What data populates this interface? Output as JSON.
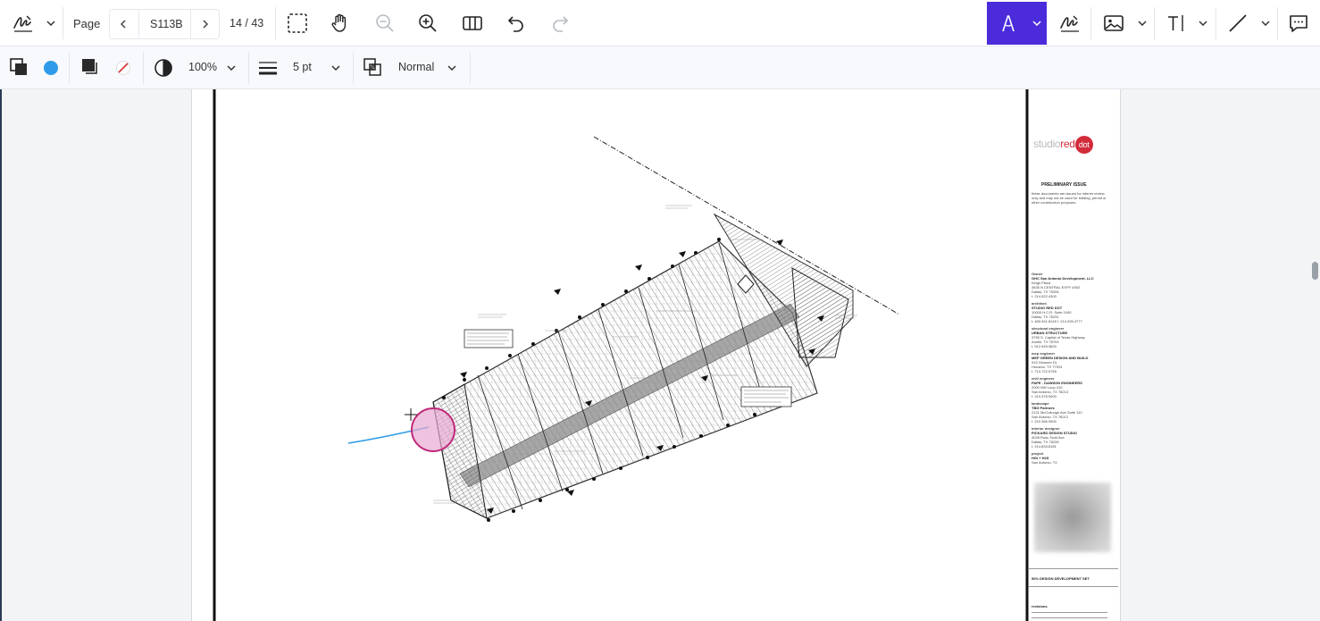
{
  "toolbar": {
    "page_label": "Page",
    "page_value": "S113B",
    "page_counter": "14 / 43",
    "accent_color": "#4c2bdb"
  },
  "props": {
    "opacity": "100%",
    "stroke_width": "5 pt",
    "blend_mode": "Normal",
    "fill_color": "#2f9be8"
  },
  "sheet": {
    "logo_text_a": "studio",
    "logo_text_b": "red",
    "logo_text_c": "dot",
    "preliminary_title": "PRELIMINARY ISSUE",
    "preliminary_text": "these documents are issued for interim review only and may not be used for bidding, permit or other construction purposes.",
    "team": [
      {
        "role": "Owner",
        "name": "GHC San Antonio Development, LLC",
        "lines": [
          "Kings Plaza",
          "4635 N CENTRAL EXPY #302",
          "Dallas, TX 75205",
          "t. 214.922.4300"
        ]
      },
      {
        "role": "architect",
        "name": "STUDIO RED DOT",
        "lines": [
          "10000 H.C.R. Suite 1040",
          "Dallas, TX 75231",
          "t. 469.941.8145  f. 214.295.4777"
        ]
      },
      {
        "role": "structural engineer",
        "name": "URBAN STRUCTURE",
        "lines": [
          "3755 S. Capital of Texas Highway",
          "Austin, TX 78704",
          "t. 512.645.3600"
        ]
      },
      {
        "role": "mep engineer",
        "name": "MEP GREEN DESIGN AND BUILD",
        "lines": [
          "915 Gessner Dr.",
          "Houston, TX 77024",
          "t. 713.722.0755"
        ]
      },
      {
        "role": "civil engineer",
        "name": "PAPE - DAWSON ENGINEERS",
        "lines": [
          "2000 NW Loop 410",
          "San Antonio, TX 78213",
          "t. 210.375.9000"
        ]
      },
      {
        "role": "landscape",
        "name": "TBG Partners",
        "lines": [
          "2121 McCullough Ave Suite 110",
          "San Antonio, TX 78212",
          "t. 210.366.9900"
        ]
      },
      {
        "role": "interior designer",
        "name": "PICKARD DESIGN STUDIO",
        "lines": [
          "4028 Ross Todd Ave.",
          "Dallas, TX 75226",
          "t. 214.833.8181"
        ]
      },
      {
        "role": "project",
        "name": "HGI + H2S",
        "lines": [
          "San Antonio, TX"
        ]
      }
    ],
    "set_title": "50% DESIGN DEVELOPMENT SET",
    "revisions_label": "revisions"
  }
}
